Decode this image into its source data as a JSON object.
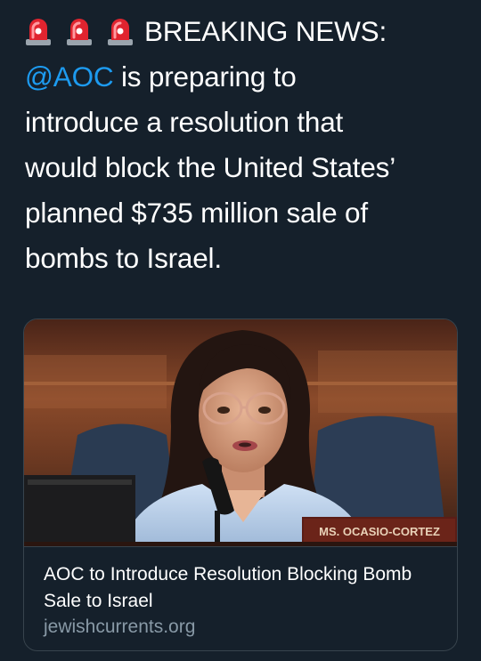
{
  "tweet": {
    "icons": [
      "rotating-light-icon",
      "rotating-light-icon",
      "rotating-light-icon"
    ],
    "headline": "BREAKING NEWS:",
    "mention": "@AOC",
    "line1_rest": " is preparing to",
    "line2": "introduce a resolution that",
    "line3": "would block the United States’",
    "line4": "planned $735 million sale of",
    "line5": "bombs to Israel."
  },
  "link_card": {
    "nameplate": "MS. OCASIO-CORTEZ",
    "title": "AOC to Introduce Resolution Blocking Bomb Sale to Israel",
    "domain": "jewishcurrents.org"
  },
  "colors": {
    "background": "#15202b",
    "mention": "#1d9bf0",
    "border": "#38444d",
    "secondary_text": "#8899a6",
    "siren_red": "#e0242f"
  }
}
